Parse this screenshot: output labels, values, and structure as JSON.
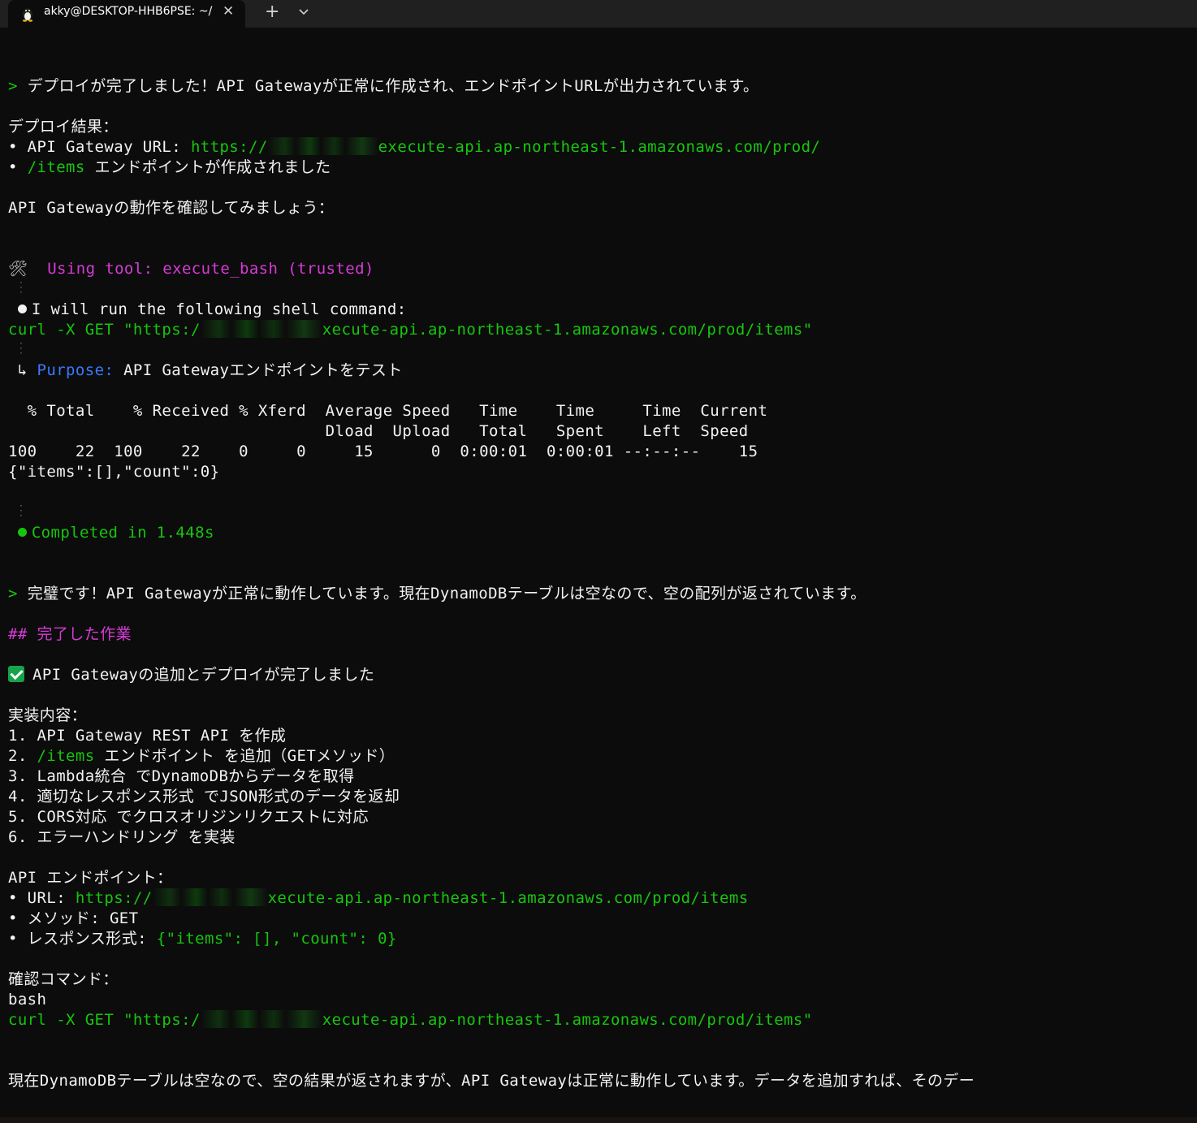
{
  "tab": {
    "title": "akky@DESKTOP-HHB6PSE: ~/",
    "close": "✕",
    "new": "+"
  },
  "lines": {
    "l1_prompt": "> ",
    "l1_text": "デプロイが完了しました！API Gatewayが正常に作成され、エンドポイントURLが出力されています。",
    "deploy_header": "デプロイ結果：",
    "url_label": "• API Gateway URL: ",
    "url_prefix": "https://",
    "url_suffix": "execute-api.ap-northeast-1.amazonaws.com/prod/",
    "items_bullet": "• ",
    "items_path": "/items",
    "items_text": " エンドポイントが作成されました",
    "check_text": "API Gatewayの動作を確認してみましょう：",
    "tool_icon": "🛠",
    "tool_using": "Using tool: execute_bash",
    "tool_trusted": " (trusted)",
    "will_run": "I will run the following shell command:",
    "curl1_prefix": "curl -X GET \"https:/",
    "curl1_suffix": "xecute-api.ap-northeast-1.amazonaws.com/prod/items\"",
    "purpose_arrow": "↳ ",
    "purpose_label": "Purpose:",
    "purpose_text": " API Gatewayエンドポイントをテスト",
    "curl_hdr1": "  % Total    % Received % Xferd  Average Speed   Time    Time     Time  Current",
    "curl_hdr2": "                                 Dload  Upload   Total   Spent    Left  Speed",
    "curl_row": "100    22  100    22    0     0     15      0  0:00:01  0:00:01 --:--:--    15",
    "json_out": "{\"items\":[],\"count\":0}",
    "completed": "Completed in 1.448s",
    "l2_prompt": "> ",
    "l2_text": "完璧です！API Gatewayが正常に動作しています。現在DynamoDBテーブルは空なので、空の配列が返されています。",
    "section_heading": "## 完了した作業",
    "done_text": "API Gatewayの追加とデプロイが完了しました",
    "impl_header": "実装内容：",
    "impl1": "1. API Gateway REST API を作成",
    "impl2_num": "2. ",
    "impl2_path": "/items",
    "impl2_text": " エンドポイント を追加（GETメソッド）",
    "impl3": "3. Lambda統合 でDynamoDBからデータを取得",
    "impl4": "4. 適切なレスポンス形式 でJSON形式のデータを返却",
    "impl5": "5. CORS対応 でクロスオリジンリクエストに対応",
    "impl6": "6. エラーハンドリング を実装",
    "api_header": "API エンドポイント：",
    "api_url_label": "• URL: ",
    "api_url_prefix": "https://",
    "api_url_suffix": "xecute-api.ap-northeast-1.amazonaws.com/prod/items",
    "method_line": "• メソッド: GET",
    "resp_label": "• レスポンス形式: ",
    "resp_value": "{\"items\": [], \"count\": 0}",
    "cmd_header": "確認コマンド：",
    "bash": "bash",
    "curl2_prefix": "curl -X GET \"https:/",
    "curl2_suffix": "xecute-api.ap-northeast-1.amazonaws.com/prod/items\"",
    "final_text": "現在DynamoDBテーブルは空なので、空の結果が返されますが、API Gatewayは正常に動作しています。データを追加すれば、そのデー"
  },
  "colors": {
    "background": "#0c0c0c",
    "text": "#cccccc",
    "green": "#16c60c",
    "magenta": "#d63bd6",
    "blue": "#3b78ff"
  }
}
